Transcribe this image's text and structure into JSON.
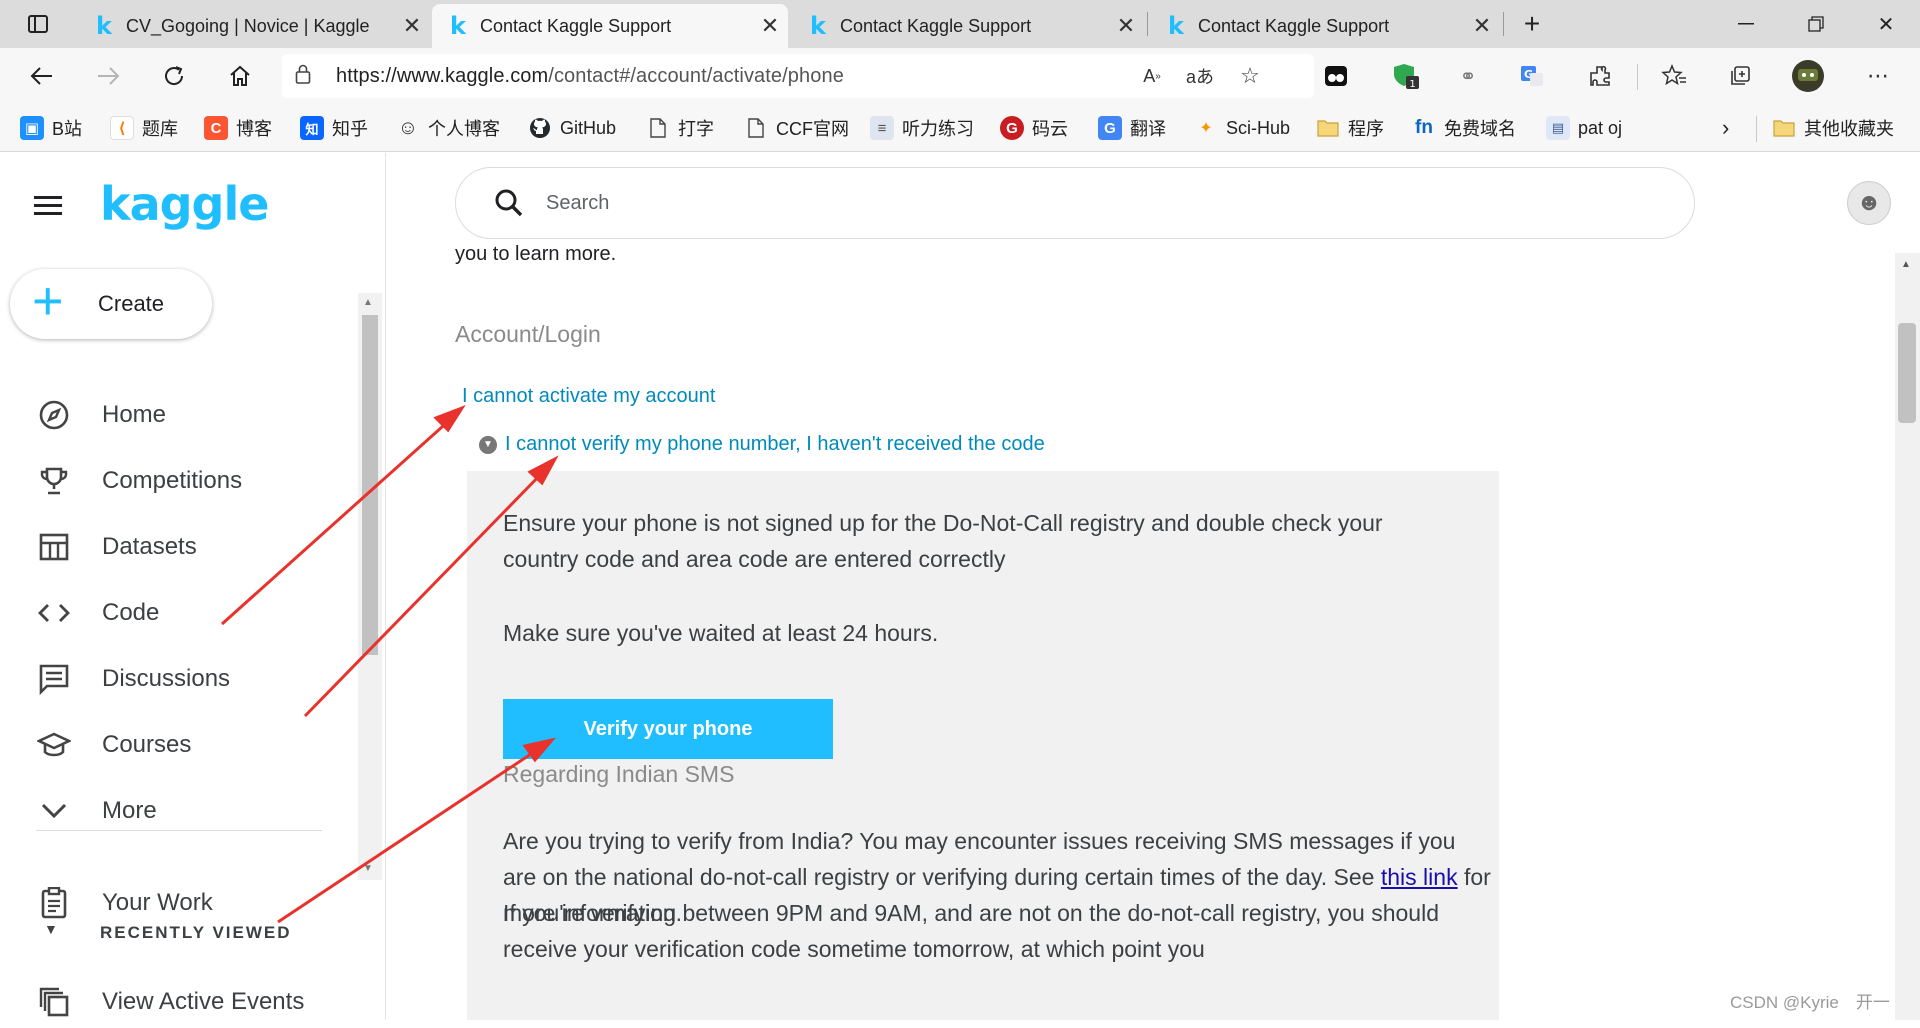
{
  "browser": {
    "tabs": [
      {
        "title": "CV_Gogoing | Novice | Kaggle",
        "icon": "kaggle-k-icon",
        "active": false
      },
      {
        "title": "Contact Kaggle Support",
        "icon": "kaggle-k-icon",
        "active": true
      },
      {
        "title": "Contact Kaggle Support",
        "icon": "kaggle-k-icon",
        "active": false
      },
      {
        "title": "Contact Kaggle Support",
        "icon": "kaggle-k-icon",
        "active": false
      }
    ],
    "url_host": "https://www.kaggle.com",
    "url_path": "/contact#/account/activate/phone",
    "bookmarks": [
      {
        "label": "B站",
        "icon": "bilibili-icon",
        "color": "#1e90ff"
      },
      {
        "label": "题库",
        "icon": "tiku-icon",
        "color": "#ff7a00"
      },
      {
        "label": "博客",
        "icon": "csdn-icon",
        "color": "#fc5531"
      },
      {
        "label": "知乎",
        "icon": "zhihu-icon",
        "color": "#0a66ff"
      },
      {
        "label": "个人博客",
        "icon": "smiley-icon",
        "color": "#333333"
      },
      {
        "label": "GitHub",
        "icon": "github-icon",
        "color": "#24292e"
      },
      {
        "label": "打字",
        "icon": "page-icon",
        "color": "#555555"
      },
      {
        "label": "CCF官网",
        "icon": "page-icon",
        "color": "#555555"
      },
      {
        "label": "听力练习",
        "icon": "doc-icon",
        "color": "#7a8ca8"
      },
      {
        "label": "码云",
        "icon": "gitee-icon",
        "color": "#c71d23"
      },
      {
        "label": "翻译",
        "icon": "translate-icon",
        "color": "#4285f4"
      },
      {
        "label": "Sci-Hub",
        "icon": "scihub-icon",
        "color": "#f29900"
      },
      {
        "label": "程序",
        "icon": "folder-icon",
        "color": "#f0c24a"
      },
      {
        "label": "免费域名",
        "icon": "freenom-icon",
        "color": "#0a66c2"
      },
      {
        "label": "pat oj",
        "icon": "pat-icon",
        "color": "#3d5a98"
      }
    ],
    "other_bookmarks": "其他收藏夹"
  },
  "sidebar": {
    "logo": "kaggle",
    "create_label": "Create",
    "items": [
      {
        "label": "Home",
        "icon": "compass-icon"
      },
      {
        "label": "Competitions",
        "icon": "trophy-icon"
      },
      {
        "label": "Datasets",
        "icon": "table-icon"
      },
      {
        "label": "Code",
        "icon": "code-icon"
      },
      {
        "label": "Discussions",
        "icon": "comment-icon"
      },
      {
        "label": "Courses",
        "icon": "graduation-cap-icon"
      },
      {
        "label": "More",
        "icon": "chevron-down-icon"
      }
    ],
    "your_work": "Your Work",
    "recently_viewed": "RECENTLY VIEWED",
    "view_active_events": "View Active Events"
  },
  "main": {
    "search_placeholder": "Search",
    "learn_more": "you to learn more.",
    "section_title": "Account/Login",
    "link_activate": "I cannot activate my account",
    "link_verify_phone": "I cannot verify my phone number, I haven't received the code",
    "panel": {
      "p1": "Ensure your phone is not signed up for the Do-Not-Call registry and double check your country code and area code are entered correctly",
      "p2": "Make sure you've waited at least 24 hours.",
      "verify_button": "Verify your phone",
      "indian_heading": "Regarding Indian SMS",
      "p3_before": "Are you trying to verify from India? You may encounter issues receiving SMS messages if you are on the national do-not-call registry or verifying during certain times of the day. See ",
      "p3_link": "this link",
      "p3_after": " for more information.",
      "p4": "If you're verifying between 9PM and 9AM, and are not on the do-not-call registry, you should receive your verification code sometime tomorrow, at which point you"
    }
  },
  "watermark": "CSDN @Kyrie　开一",
  "colors": {
    "kaggle_blue": "#20beff",
    "link": "#008abc",
    "annotation_red": "#e8322b"
  }
}
